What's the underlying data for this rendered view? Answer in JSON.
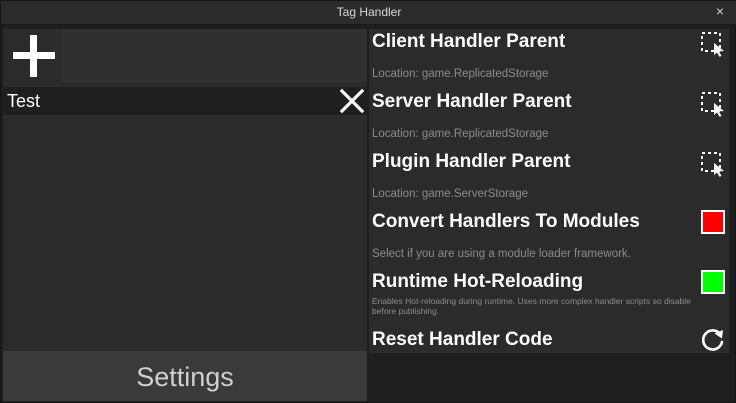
{
  "window": {
    "title": "Tag Handler",
    "close_label": "×"
  },
  "left": {
    "add_icon": "plus-icon",
    "tag_input_value": "",
    "tags": [
      {
        "label": "Test",
        "remove_icon": "close-icon"
      }
    ],
    "settings_label": "Settings"
  },
  "settings": {
    "client_parent": {
      "heading": "Client Handler Parent",
      "location": "Location: game.ReplicatedStorage",
      "icon": "select-cursor-icon"
    },
    "server_parent": {
      "heading": "Server Handler Parent",
      "location": "Location: game.ReplicatedStorage",
      "icon": "select-cursor-icon"
    },
    "plugin_parent": {
      "heading": "Plugin Handler Parent",
      "location": "Location: game.ServerStorage",
      "icon": "select-cursor-icon"
    },
    "convert_modules": {
      "heading": "Convert Handlers To Modules",
      "description": "Select if you are using a module loader framework.",
      "checked": false,
      "color": "#ff0000"
    },
    "hot_reload": {
      "heading": "Runtime Hot-Reloading",
      "description": "Enables Hot-reloading during runtime. Uses more complex handler scripts so disable before publishing.",
      "checked": true,
      "color": "#00ff00"
    },
    "reset_code": {
      "heading": "Reset Handler Code",
      "icon": "reset-icon"
    }
  }
}
